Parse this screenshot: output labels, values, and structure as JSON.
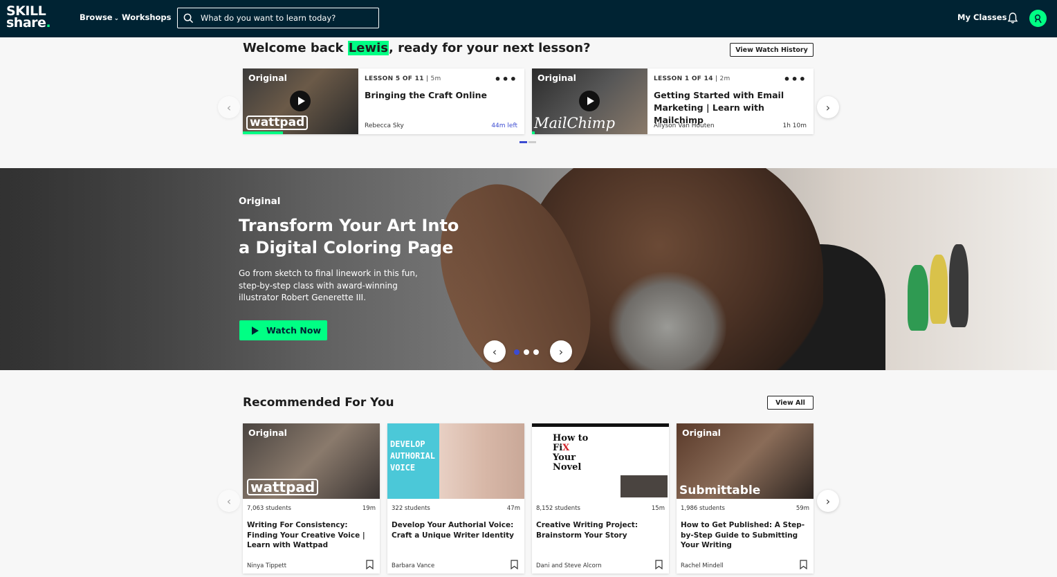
{
  "nav": {
    "logo_line1": "SKILL",
    "logo_line2": "share",
    "logo_dot": ".",
    "browse": "Browse",
    "workshops": "Workshops",
    "search_placeholder": "What do you want to learn today?",
    "my_classes": "My Classes"
  },
  "welcome": {
    "prefix": "Welcome back ",
    "name": "Lewis",
    "suffix": ", ready for your next lesson?",
    "history_button": "View Watch History"
  },
  "lessons": [
    {
      "badge": "Original",
      "lesson_label": "LESSON 5 OF 11",
      "duration": "5m",
      "title": "Bringing the Craft Online",
      "teacher": "Rebecca Sky",
      "time": "44m left",
      "brand": "wattpad",
      "progress": 0.35
    },
    {
      "badge": "Original",
      "lesson_label": "LESSON 1 OF 14",
      "duration": "2m",
      "title": "Getting Started with Email Marketing | Learn with Mailchimp",
      "teacher": "Allyson Van Houten",
      "time": "1h 10m",
      "brand": "MailChimp",
      "progress": 0.02
    }
  ],
  "hero": {
    "eyebrow": "Original",
    "title": "Transform Your Art Into a Digital Coloring Page",
    "description": "Go from sketch to final linework in this fun, step-by-step class with award-winning illustrator Robert Generette III.",
    "button": "Watch Now"
  },
  "recommended": {
    "title": "Recommended For You",
    "view_all": "View All",
    "courses": [
      {
        "badge": "Original",
        "brand": "wattpad",
        "students": "7,063 students",
        "duration": "19m",
        "title": "Writing For Consistency: Finding Your Creative Voice | Learn with Wattpad",
        "teacher": "Ninya Tippett"
      },
      {
        "thumb_text": "DEVELOP AUTHORIAL VOICE",
        "students": "322 students",
        "duration": "47m",
        "title": "Develop Your Authorial Voice: Craft a Unique Writer Identity",
        "teacher": "Barbara Vance"
      },
      {
        "thumb_text_1": "How to",
        "thumb_text_2": "Fi",
        "thumb_text_x": "X",
        "thumb_text_3": "Your",
        "thumb_text_4": "Novel",
        "students": "8,152 students",
        "duration": "15m",
        "title": "Creative Writing Project: Brainstorm Your Story",
        "teacher": "Dani and Steve Alcorn"
      },
      {
        "badge": "Original",
        "brand": "Submittable",
        "students": "1,986 students",
        "duration": "59m",
        "title": "How to Get Published: A Step-by-Step Guide to Submitting Your Writing",
        "teacher": "Rachel Mindell"
      }
    ]
  },
  "colors": {
    "nav_bg": "#002333",
    "accent_green": "#00ff84",
    "accent_blue": "#3b4bd1"
  }
}
